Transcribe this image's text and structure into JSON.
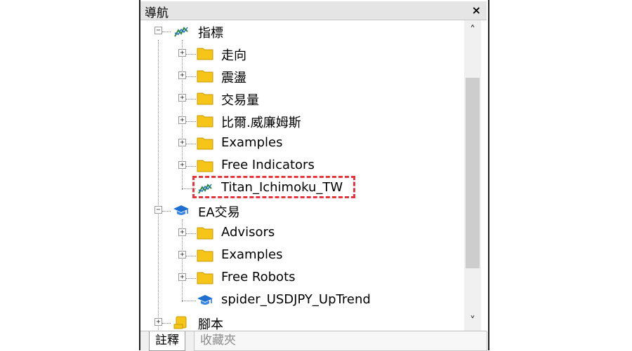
{
  "panel": {
    "title": "導航",
    "close": "×"
  },
  "tree": {
    "indicators": {
      "label": "指標",
      "children": [
        "走向",
        "震盪",
        "交易量",
        "比爾.威廉姆斯",
        "Examples",
        "Free Indicators"
      ],
      "file": "Titan_Ichimoku_TW"
    },
    "ea": {
      "label": "EA交易",
      "children": [
        "Advisors",
        "Examples",
        "Free Robots"
      ],
      "file": "spider_USDJPY_UpTrend"
    },
    "scripts": {
      "label": "腳本"
    }
  },
  "scroll": {
    "up": "˄",
    "down": "˅"
  },
  "tabs": [
    "註釋",
    "收藏夾"
  ],
  "colors": {
    "folder": "#f5c518",
    "folder_edge": "#c99a00",
    "indicator_icon": "#2c8c2c",
    "ea_icon": "#1e6fd0",
    "highlight": "#e8343c"
  }
}
